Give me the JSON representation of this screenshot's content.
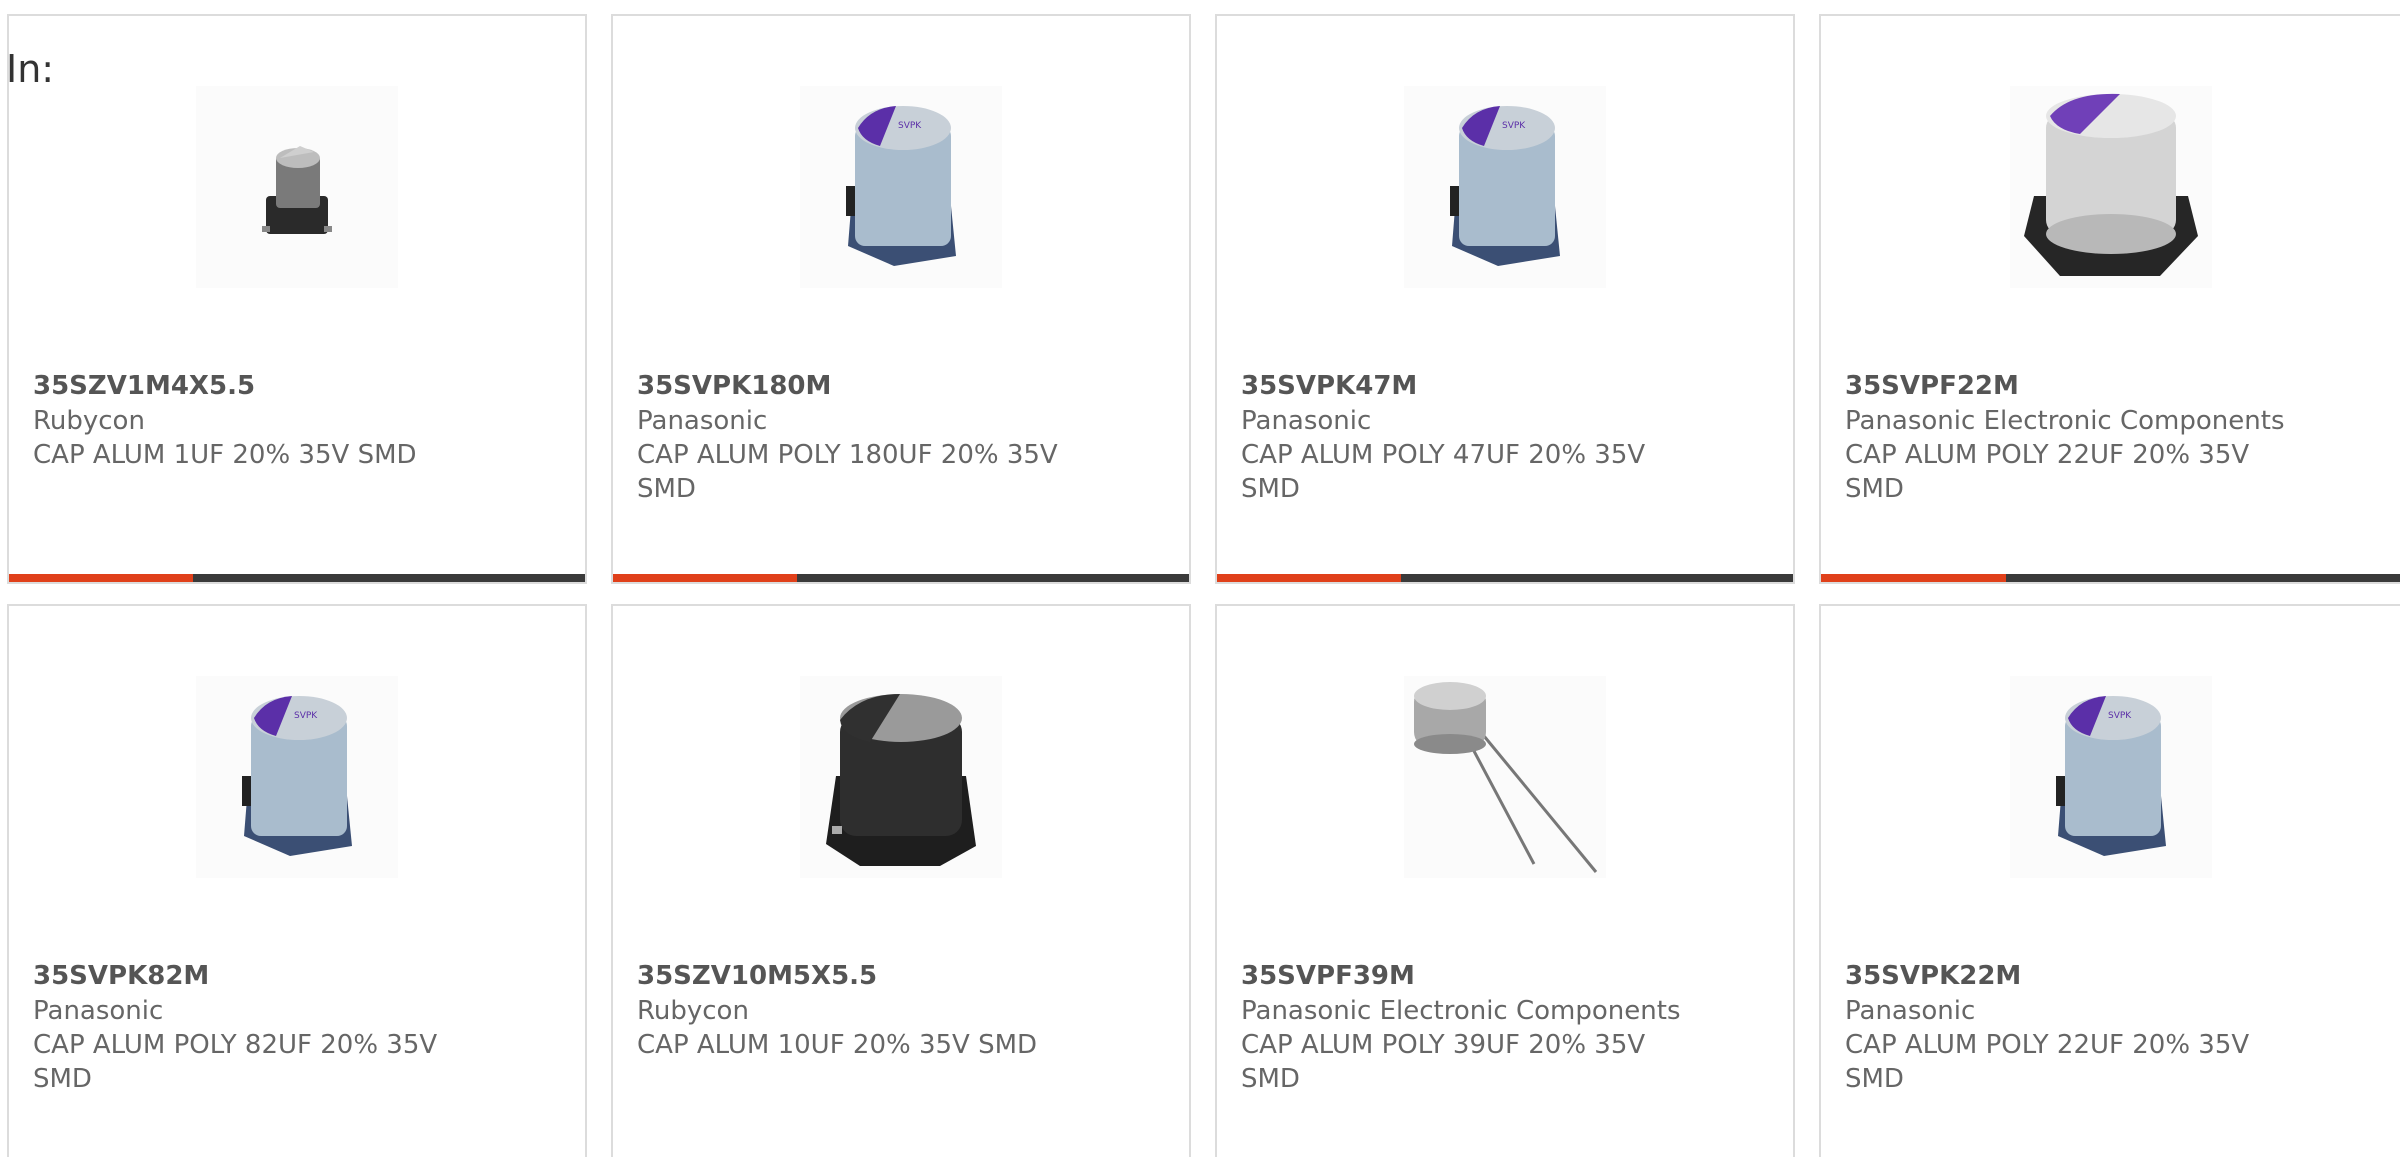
{
  "header": {
    "in_label": "In:"
  },
  "colors": {
    "accent": "#e0401a",
    "bar_track": "#3a3a3a",
    "border": "#dcdcdc"
  },
  "cards": [
    {
      "part": "35SZV1M4X5.5",
      "manufacturer": "Rubycon",
      "description": "CAP ALUM 1UF 20% 35V SMD",
      "image": "smd-capacitor-small-icon",
      "progress": 0.32
    },
    {
      "part": "35SVPK180M",
      "manufacturer": "Panasonic",
      "description": "CAP ALUM POLY 180UF 20% 35V SMD",
      "image": "polymer-capacitor-purple-icon",
      "progress": 0.32
    },
    {
      "part": "35SVPK47M",
      "manufacturer": "Panasonic",
      "description": "CAP ALUM POLY 47UF 20% 35V SMD",
      "image": "polymer-capacitor-purple-icon",
      "progress": 0.32
    },
    {
      "part": "35SVPF22M",
      "manufacturer": "Panasonic Electronic Components",
      "description": "CAP ALUM POLY 22UF 20% 35V SMD",
      "image": "polymer-capacitor-silver-icon",
      "progress": 0.32
    },
    {
      "part": "35SVPK82M",
      "manufacturer": "Panasonic",
      "description": "CAP ALUM POLY 82UF 20% 35V SMD",
      "image": "polymer-capacitor-purple-icon",
      "progress": 0.32
    },
    {
      "part": "35SZV10M5X5.5",
      "manufacturer": "Rubycon",
      "description": "CAP ALUM 10UF 20% 35V SMD",
      "image": "smd-capacitor-black-icon",
      "progress": 0.32
    },
    {
      "part": "35SVPF39M",
      "manufacturer": "Panasonic Electronic Components",
      "description": "CAP ALUM POLY 39UF 20% 35V SMD",
      "image": "radial-capacitor-icon",
      "progress": 0.32
    },
    {
      "part": "35SVPK22M",
      "manufacturer": "Panasonic",
      "description": "CAP ALUM POLY 22UF 20% 35V SMD",
      "image": "polymer-capacitor-purple-icon",
      "progress": 0.32
    }
  ]
}
